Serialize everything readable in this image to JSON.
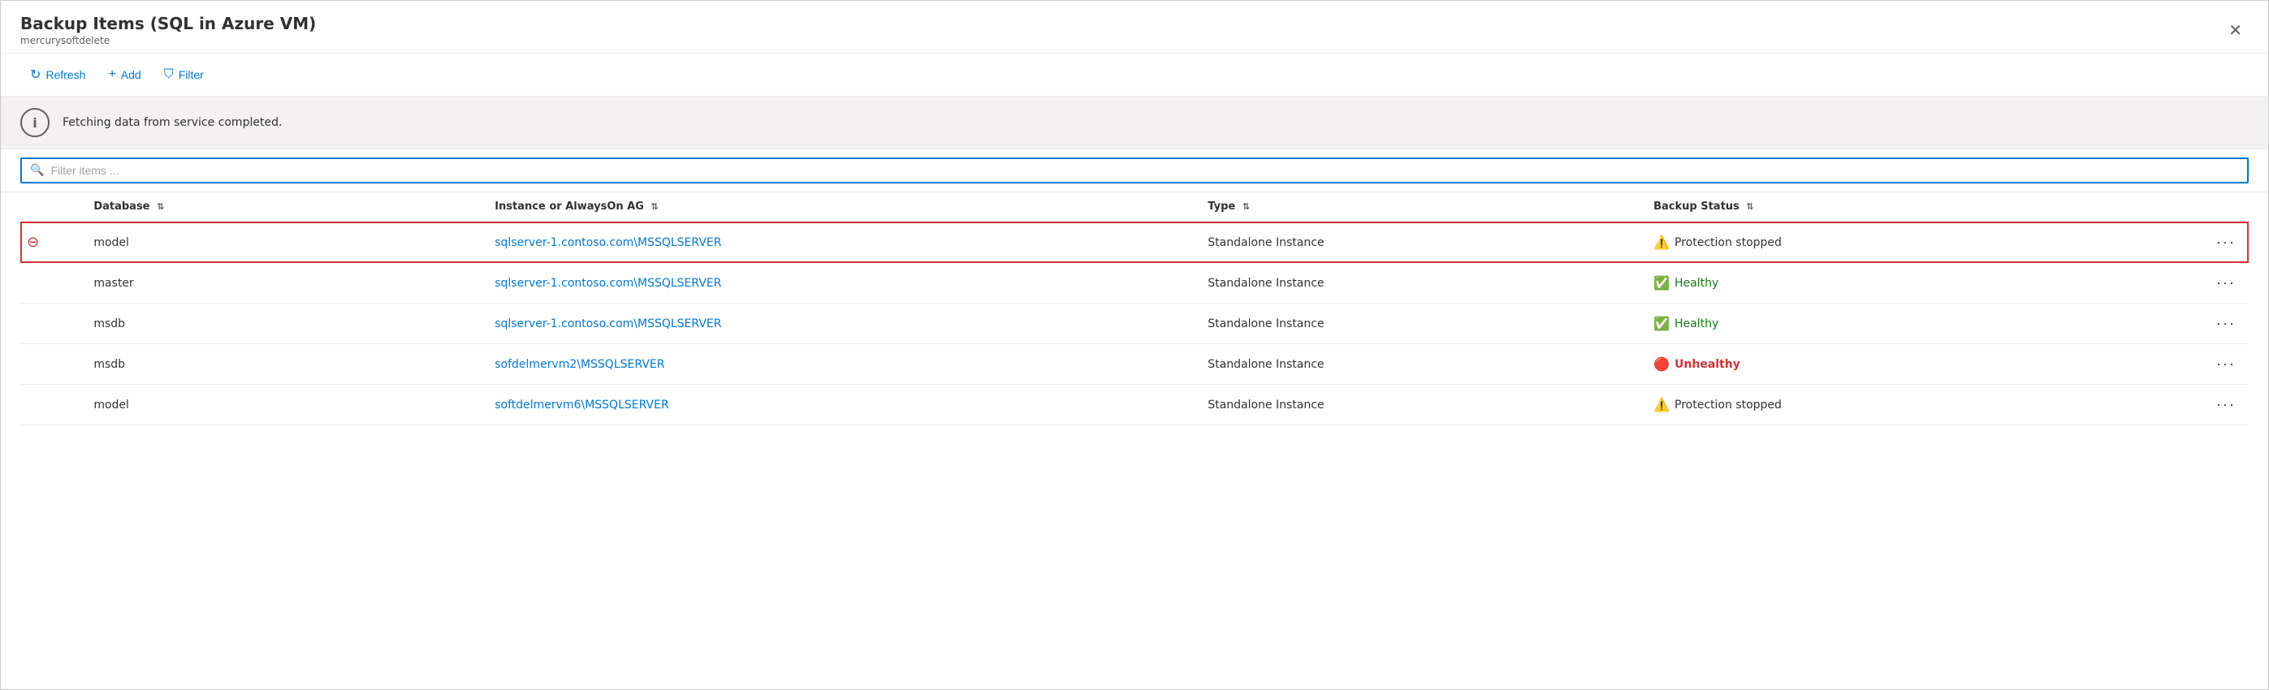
{
  "window": {
    "title": "Backup Items (SQL in Azure VM)",
    "subtitle": "mercurysoftdelete",
    "close_label": "✕"
  },
  "toolbar": {
    "refresh_label": "Refresh",
    "add_label": "Add",
    "filter_label": "Filter"
  },
  "banner": {
    "message": "Fetching data from service completed."
  },
  "search": {
    "placeholder": "Filter items ..."
  },
  "table": {
    "columns": [
      {
        "key": "icon",
        "label": ""
      },
      {
        "key": "database",
        "label": "Database"
      },
      {
        "key": "instance",
        "label": "Instance or AlwaysOn AG"
      },
      {
        "key": "type",
        "label": "Type"
      },
      {
        "key": "status",
        "label": "Backup Status"
      },
      {
        "key": "actions",
        "label": ""
      }
    ],
    "rows": [
      {
        "id": 1,
        "selected": true,
        "stop_icon": true,
        "database": "model",
        "instance": "sqlserver-1.contoso.com\\MSSQLSERVER",
        "type": "Standalone Instance",
        "status_type": "protection_stopped",
        "status_label": "Protection stopped"
      },
      {
        "id": 2,
        "selected": false,
        "stop_icon": false,
        "database": "master",
        "instance": "sqlserver-1.contoso.com\\MSSQLSERVER",
        "type": "Standalone Instance",
        "status_type": "healthy",
        "status_label": "Healthy"
      },
      {
        "id": 3,
        "selected": false,
        "stop_icon": false,
        "database": "msdb",
        "instance": "sqlserver-1.contoso.com\\MSSQLSERVER",
        "type": "Standalone Instance",
        "status_type": "healthy",
        "status_label": "Healthy"
      },
      {
        "id": 4,
        "selected": false,
        "stop_icon": false,
        "database": "msdb",
        "instance": "sofdelmervm2\\MSSQLSERVER",
        "type": "Standalone Instance",
        "status_type": "unhealthy",
        "status_label": "Unhealthy"
      },
      {
        "id": 5,
        "selected": false,
        "stop_icon": false,
        "database": "model",
        "instance": "softdelmervm6\\MSSQLSERVER",
        "type": "Standalone Instance",
        "status_type": "protection_stopped",
        "status_label": "Protection stopped"
      }
    ]
  }
}
